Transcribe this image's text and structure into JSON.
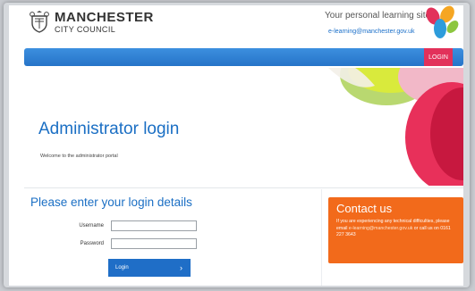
{
  "header": {
    "logo_line1": "MANCHESTER",
    "logo_line2": "CITY COUNCIL",
    "tagline": "Your personal learning site",
    "email": "e-learning@manchester.gov.uk"
  },
  "navbar": {
    "login_label": "LOGIN"
  },
  "hero": {
    "title": "Administrator login",
    "subtitle": "Welcome to the administrator portal"
  },
  "login_form": {
    "title": "Please enter your login details",
    "username_label": "Username",
    "username_value": "",
    "password_label": "Password",
    "password_value": "",
    "button_label": "Login",
    "button_chevron": "›"
  },
  "contact": {
    "title": "Contact us",
    "text_before": "If you are experiencing any technical difficulties, please email ",
    "email": "e-learning@manchester.gov.uk",
    "text_after": " or call us on 0161 227 3643"
  },
  "colors": {
    "accent_blue": "#1b6fc4",
    "navbar_blue": "#2f82d6",
    "login_tab": "#e2315a",
    "contact_orange": "#f26a1b"
  },
  "icons": {
    "crest": "council-crest-icon",
    "brand": "brand-petals-icon",
    "chevron": "chevron-right-icon"
  }
}
